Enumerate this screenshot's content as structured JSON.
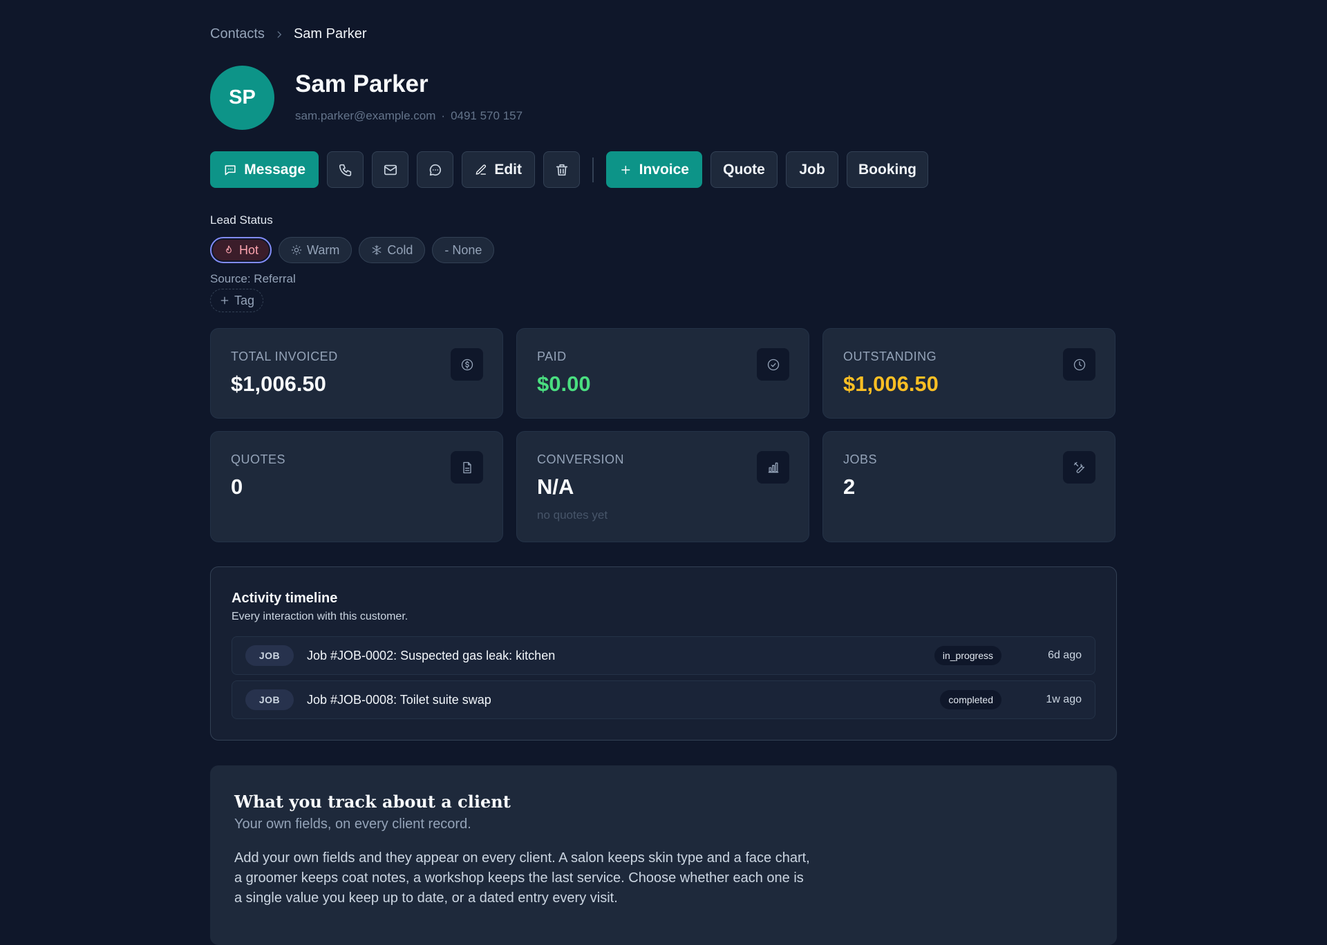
{
  "breadcrumb": {
    "parent": "Contacts",
    "current": "Sam Parker"
  },
  "contact": {
    "initials": "SP",
    "name": "Sam Parker",
    "email": "sam.parker@example.com",
    "separator": "·",
    "phone": "0491 570 157"
  },
  "toolbar": {
    "message_label": "Message",
    "edit_label": "Edit",
    "invoice_label": "Invoice",
    "quote_label": "Quote",
    "job_label": "Job",
    "booking_label": "Booking"
  },
  "lead": {
    "label": "Lead Status",
    "options": [
      "Hot",
      "Warm",
      "Cold",
      "- None"
    ],
    "selected": "Hot",
    "source": "Source: Referral",
    "tag_label": "Tag"
  },
  "stats": {
    "total_invoiced": {
      "label": "TOTAL INVOICED",
      "value": "$1,006.50",
      "icon": "dollar-icon"
    },
    "paid": {
      "label": "PAID",
      "value": "$0.00",
      "icon": "check-circle-icon",
      "color": "#4ade80"
    },
    "outstanding": {
      "label": "OUTSTANDING",
      "value": "$1,006.50",
      "icon": "clock-icon",
      "color": "#fbbf24"
    },
    "quotes": {
      "label": "QUOTES",
      "value": "0",
      "icon": "file-icon"
    },
    "conversion": {
      "label": "CONVERSION",
      "value": "N/A",
      "hint": "no quotes yet",
      "icon": "bar-chart-icon"
    },
    "jobs": {
      "label": "JOBS",
      "value": "2",
      "icon": "wrench-icon"
    }
  },
  "timeline": {
    "title": "Activity timeline",
    "subtitle": "Every interaction with this customer.",
    "items": [
      {
        "kind": "JOB",
        "text": "Job #JOB-0002: Suspected gas leak: kitchen",
        "status": "in_progress",
        "when": "6d ago"
      },
      {
        "kind": "JOB",
        "text": "Job #JOB-0008: Toilet suite swap",
        "status": "completed",
        "when": "1w ago"
      }
    ]
  },
  "custom_fields": {
    "title": "What you track about a client",
    "subtitle": "Your own fields, on every client record.",
    "body": "Add your own fields and they appear on every client. A salon keeps skin type and a face chart, a groomer keeps coat notes, a workshop keeps the last service. Choose whether each one is a single value you keep up to date, or a dated entry every visit."
  },
  "colors": {
    "accent": "#0d9488",
    "background": "#0f172a",
    "card": "#1e293b"
  }
}
